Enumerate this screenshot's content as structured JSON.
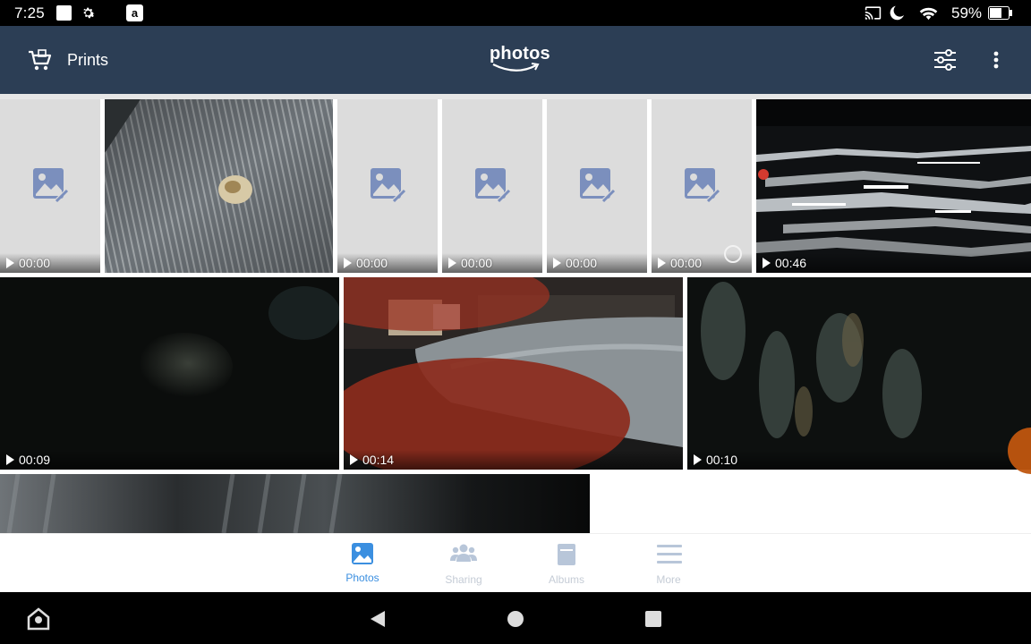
{
  "status_bar": {
    "time": "7:25",
    "battery_percent": "59%",
    "icons": [
      "notification-square-icon",
      "settings-gear-icon",
      "amazon-icon",
      "cast-icon",
      "do-not-disturb-moon-icon",
      "wifi-icon",
      "battery-icon"
    ]
  },
  "app_bar": {
    "prints_label": "Prints",
    "logo_text": "photos",
    "colors": {
      "background": "#2c3e55",
      "accent": "#3b8fe0"
    }
  },
  "media": [
    {
      "kind": "video",
      "duration": "00:00",
      "thumbnail": "placeholder-image-icon"
    },
    {
      "kind": "photo",
      "thumbnail": "knit-fabric-with-button"
    },
    {
      "kind": "video",
      "duration": "00:00",
      "thumbnail": "placeholder-image-icon"
    },
    {
      "kind": "video",
      "duration": "00:00",
      "thumbnail": "placeholder-image-icon"
    },
    {
      "kind": "video",
      "duration": "00:00",
      "thumbnail": "placeholder-image-icon"
    },
    {
      "kind": "video",
      "duration": "00:00",
      "thumbnail": "placeholder-image-icon",
      "loading": true
    },
    {
      "kind": "video",
      "duration": "00:46",
      "thumbnail": "glitchy-dark-streaks"
    },
    {
      "kind": "video",
      "duration": "00:09",
      "thumbnail": "dark-blurry-scene"
    },
    {
      "kind": "video",
      "duration": "00:14",
      "thumbnail": "blanket-with-finger"
    },
    {
      "kind": "video",
      "duration": "00:10",
      "thumbnail": "dark-blurry-texture"
    },
    {
      "kind": "photo",
      "thumbnail": "dark-blurry-partial"
    }
  ],
  "bottom_nav": {
    "items": [
      {
        "label": "Photos",
        "icon": "photos-icon",
        "active": true
      },
      {
        "label": "Sharing",
        "icon": "sharing-people-icon",
        "active": false
      },
      {
        "label": "Albums",
        "icon": "albums-icon",
        "active": false
      },
      {
        "label": "More",
        "icon": "menu-lines-icon",
        "active": false
      }
    ]
  },
  "system_nav": {
    "icons": [
      "home-kids-icon",
      "back-triangle-icon",
      "home-circle-icon",
      "recents-square-icon"
    ]
  }
}
